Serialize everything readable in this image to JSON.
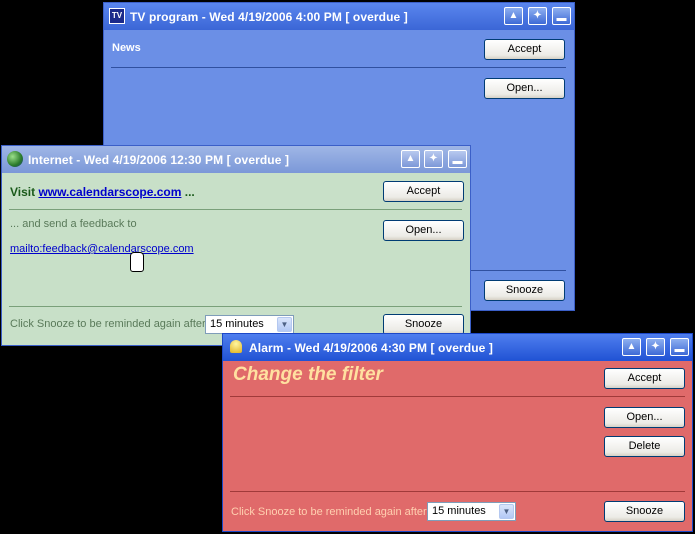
{
  "tv_window": {
    "title": "TV program - Wed 4/19/2006 4:00 PM [ overdue ]",
    "heading": "News",
    "accept": "Accept",
    "open": "Open...",
    "snooze": "Snooze",
    "icon": "tv-icon",
    "bg_color": "#6b8fe6"
  },
  "internet_window": {
    "title": "Internet - Wed 4/19/2006 12:30 PM [ overdue ]",
    "visit": "Visit",
    "url": "www.calendarscope.com",
    "ellipsis": "...",
    "feedback_text": "... and send a feedback to",
    "mailto": "mailto:feedback@calendarscope.com",
    "snooze_text": "Click Snooze to be reminded again after:",
    "snooze_value": "15 minutes",
    "accept": "Accept",
    "open": "Open...",
    "snooze": "Snooze",
    "icon": "globe-icon",
    "bg_color": "#c8e0c8"
  },
  "alarm_window": {
    "title": "Alarm - Wed 4/19/2006 4:30 PM [ overdue ]",
    "heading": "Change the filter",
    "snooze_text": "Click Snooze to be reminded again after:",
    "snooze_value": "15 minutes",
    "accept": "Accept",
    "open": "Open...",
    "delete": "Delete",
    "snooze": "Snooze",
    "icon": "bell-icon",
    "bg_color": "#e06a6a"
  },
  "colors": {
    "title_bar": "#2b5fd9",
    "link": "#0000cc",
    "alarm_heading": "#ffe0a0"
  }
}
